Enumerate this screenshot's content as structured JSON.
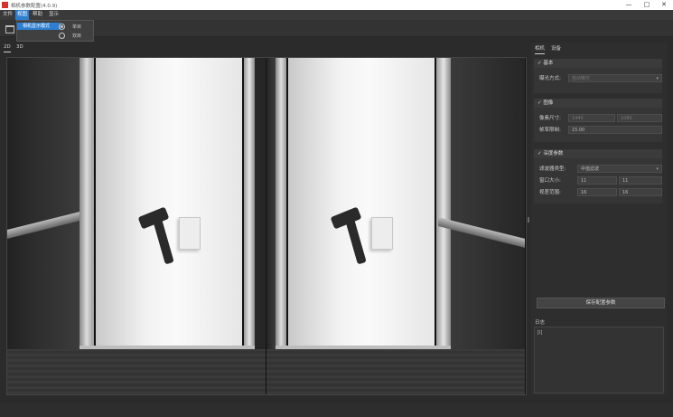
{
  "window": {
    "title": "相机参数配置(4.0.9)",
    "minimize": "—",
    "maximize": "□",
    "close": "✕"
  },
  "menubar": {
    "items": [
      {
        "label": "文件",
        "active": false
      },
      {
        "label": "视图",
        "active": true
      },
      {
        "label": "帮助",
        "active": false
      },
      {
        "label": "显示",
        "active": false
      }
    ]
  },
  "dropdown": {
    "item": "相机显示模式",
    "options": [
      {
        "label": "单目",
        "checked": true
      },
      {
        "label": "双目",
        "checked": false
      }
    ]
  },
  "view_tabs": [
    {
      "label": "2D",
      "selected": true
    },
    {
      "label": "3D",
      "selected": false
    }
  ],
  "panel": {
    "tabs": [
      {
        "label": "相机",
        "selected": true
      },
      {
        "label": "设备",
        "selected": false
      }
    ],
    "section1": {
      "header": "基本",
      "row1_label": "曝光方式:",
      "row1_value": "自动曝光"
    },
    "section2": {
      "header": "图像",
      "row1_label": "像素尺寸:",
      "row1_value_a": "1440",
      "row1_value_b": "1080",
      "row2_label": "帧率限制:",
      "row2_value": "15.00"
    },
    "section3": {
      "header": "深度参数",
      "row1_label": "滤波器类型:",
      "row1_value": "中值滤波",
      "row2_label": "窗口大小:",
      "row2_value_a": "11",
      "row2_value_b": "11",
      "row3_label": "视差范围:",
      "row3_value_a": "16",
      "row3_value_b": "16"
    },
    "apply_button": "保存配置参数",
    "log_label": "日志",
    "log_text": "[I]"
  }
}
